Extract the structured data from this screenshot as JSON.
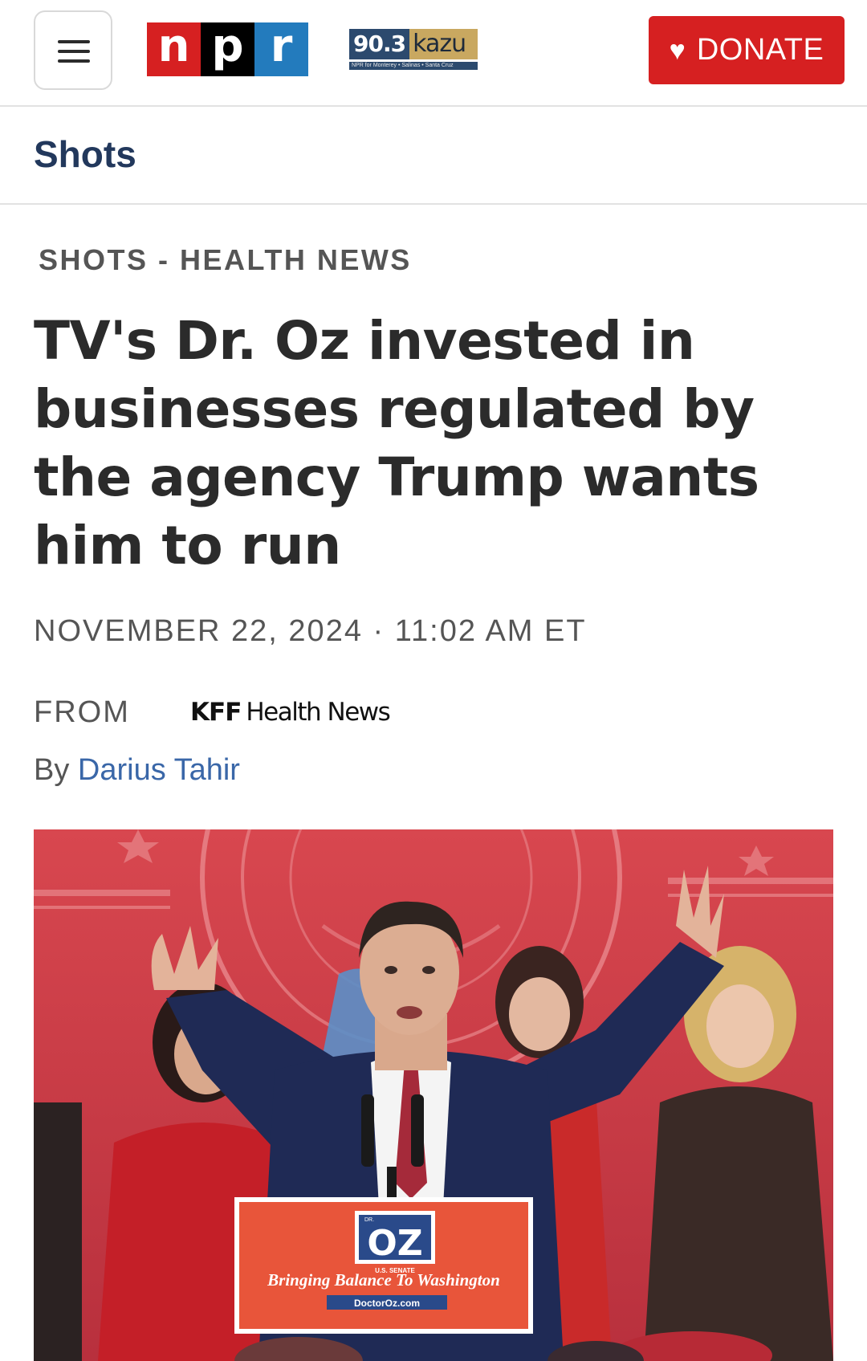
{
  "header": {
    "menu_icon": "hamburger-menu-icon",
    "npr_letters": [
      "n",
      "p",
      "r"
    ],
    "station": {
      "frequency": "90.3",
      "name": "kazu",
      "tagline": "NPR for Monterey • Salinas • Santa Cruz"
    },
    "donate": {
      "icon": "heart-icon",
      "label": "DONATE"
    }
  },
  "section": {
    "title": "Shots"
  },
  "article": {
    "kicker": "SHOTS - HEALTH NEWS",
    "headline": "TV's Dr. Oz invested in businesses regulated by the agency Trump wants him to run",
    "dateline": "NOVEMBER 22, 2024 · 11:02 AM ET",
    "from_label": "FROM",
    "partner": {
      "bold": "KFF",
      "rest": "Health News"
    },
    "byline_prefix": "By",
    "author": "Darius Tahir"
  },
  "photo": {
    "sign": {
      "small_top": "DR.",
      "big": "OZ",
      "sub": "U.S. SENATE",
      "slogan": "Bringing Balance To Washington",
      "url": "DoctorOz.com"
    },
    "colors": {
      "background": "#c93a45",
      "sign": "#e8553a",
      "suit": "#1f2a55"
    }
  }
}
